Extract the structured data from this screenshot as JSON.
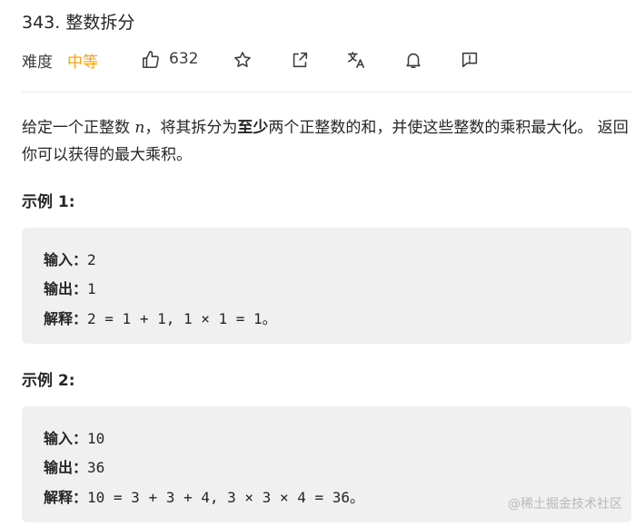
{
  "problem": {
    "title": "343. 整数拆分",
    "difficulty_label": "难度",
    "difficulty_value": "中等",
    "likes": "632"
  },
  "icons": {
    "like": "thumbs-up-icon",
    "favorite": "star-icon",
    "share": "share-icon",
    "translate": "translate-icon",
    "notify": "bell-icon",
    "feedback": "feedback-icon"
  },
  "description": {
    "p1": "给定一个正整数 ",
    "var": "n",
    "p2": "，将其拆分为",
    "bold": "至少",
    "p3": "两个正整数的和，并使这些整数的乘积最大化。 返回你可以获得的最大乘积。"
  },
  "examples": [
    {
      "title": "示例 1:",
      "input_label": "输入：",
      "input": "2",
      "output_label": "输出：",
      "output": "1",
      "explain_label": "解释：",
      "explain": "2 = 1 + 1, 1 × 1 = 1。"
    },
    {
      "title": "示例 2:",
      "input_label": "输入：",
      "input": "10",
      "output_label": "输出：",
      "output": "36",
      "explain_label": "解释：",
      "explain": "10 = 3 + 3 + 4, 3 × 3 × 4 = 36。"
    }
  ],
  "watermark": "@稀土掘金技术社区",
  "colors": {
    "difficulty_medium": "#ffa116",
    "example_bg": "#f0f0f0"
  }
}
